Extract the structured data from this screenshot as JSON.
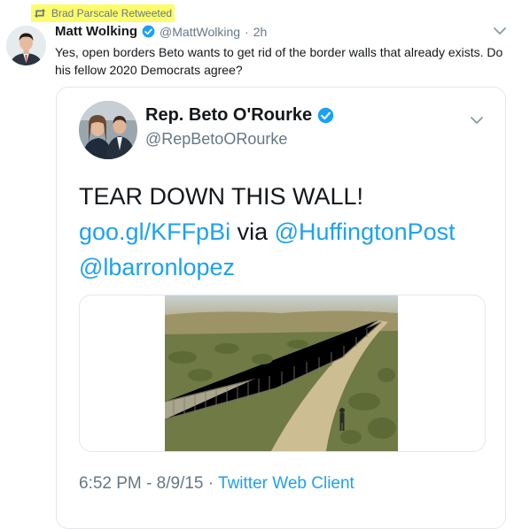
{
  "retweet": {
    "label": "Brad Parscale Retweeted",
    "highlight_color": "#fdfd6a"
  },
  "tweet": {
    "name": "Matt Wolking",
    "handle": "@MattWolking",
    "separator": "·",
    "time": "2h",
    "text": "Yes, open borders Beto wants to get rid of the border walls that already exists. Do his fellow 2020 Democrats agree?"
  },
  "quoted": {
    "name": "Rep. Beto O'Rourke",
    "handle": "@RepBetoORourke",
    "text_plain_1": "TEAR DOWN THIS WALL! ",
    "link_1": "goo.gl/KFFpBi",
    "text_plain_2": " via ",
    "mention_1": "@HuffingtonPost",
    "mention_2": "@lbarronlopez",
    "time": "6:52 PM",
    "separator": " - ",
    "date": "8/9/15",
    "middot": " · ",
    "source": "Twitter Web Client"
  },
  "icons": {
    "retweet": "retweet-icon",
    "verified": "verified-badge-icon",
    "more": "chevron-down-icon"
  },
  "colors": {
    "link": "#1da1f2",
    "muted": "#657786",
    "text": "#14171a",
    "border": "#e1e8ed"
  }
}
